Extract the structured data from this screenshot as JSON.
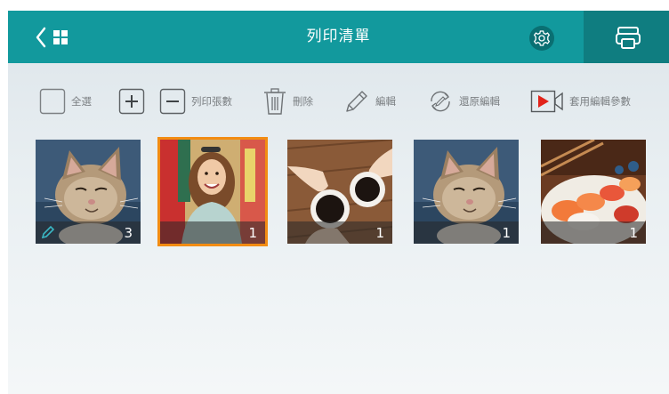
{
  "header": {
    "title": "列印清單",
    "back_icon": "chevron-left-icon",
    "grid_icon": "grid-icon",
    "settings_icon": "gear-icon",
    "print_icon": "printer-icon",
    "accent_color": "#12999d",
    "print_area_color": "#0f7d80"
  },
  "toolbar": {
    "select_all": "全選",
    "print_count": "列印張數",
    "delete": "刪除",
    "edit": "編輯",
    "restore_edit": "還原編輯",
    "apply_edit_params": "套用編輯參數"
  },
  "thumbnails": [
    {
      "subject": "kitten",
      "count": "3",
      "edited": true,
      "selected": false
    },
    {
      "subject": "smiling-woman",
      "count": "1",
      "edited": false,
      "selected": true
    },
    {
      "subject": "coffee-cups",
      "count": "1",
      "edited": false,
      "selected": false
    },
    {
      "subject": "kitten",
      "count": "1",
      "edited": false,
      "selected": false
    },
    {
      "subject": "sushi",
      "count": "1",
      "edited": false,
      "selected": false
    }
  ],
  "colors": {
    "selection": "#f28c13",
    "edit_pen": "#3ab7c4",
    "play_red": "#e2231a"
  }
}
